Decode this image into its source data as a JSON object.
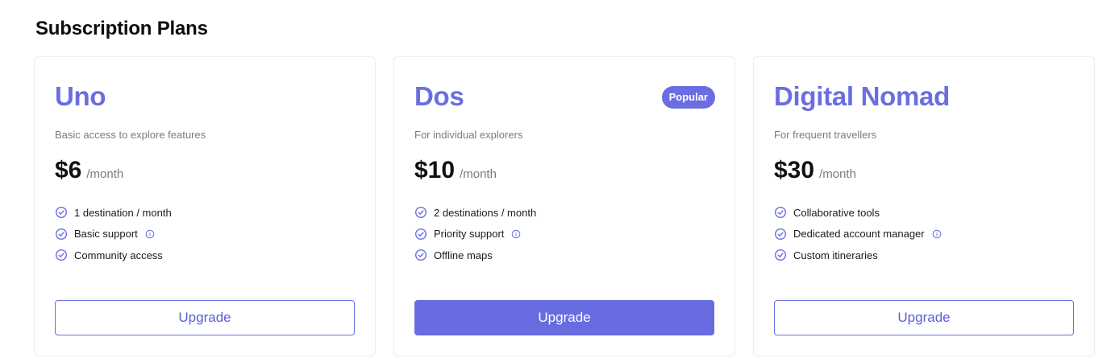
{
  "page": {
    "title": "Subscription Plans"
  },
  "colors": {
    "accent": "#6a6ee0",
    "muted": "#7a7a82",
    "border": "#ececf0"
  },
  "plans": [
    {
      "name": "Uno",
      "badge": "",
      "description": "Basic access to explore features",
      "price": "$6",
      "period": "/month",
      "features": [
        {
          "text": "1 destination / month",
          "info": false
        },
        {
          "text": "Basic support",
          "info": true
        },
        {
          "text": "Community access",
          "info": false
        }
      ],
      "button": "Upgrade",
      "button_style": "outline"
    },
    {
      "name": "Dos",
      "badge": "Popular",
      "description": "For individual explorers",
      "price": "$10",
      "period": "/month",
      "features": [
        {
          "text": "2 destinations / month",
          "info": false
        },
        {
          "text": "Priority support",
          "info": true
        },
        {
          "text": "Offline maps",
          "info": false
        }
      ],
      "button": "Upgrade",
      "button_style": "solid"
    },
    {
      "name": "Digital Nomad",
      "badge": "",
      "description": "For frequent travellers",
      "price": "$30",
      "period": "/month",
      "features": [
        {
          "text": "Collaborative tools",
          "info": false
        },
        {
          "text": "Dedicated account manager",
          "info": true
        },
        {
          "text": "Custom itineraries",
          "info": false
        }
      ],
      "button": "Upgrade",
      "button_style": "outline"
    }
  ],
  "icons": {
    "feature": "check-circle-icon",
    "info": "info-circle-icon"
  }
}
